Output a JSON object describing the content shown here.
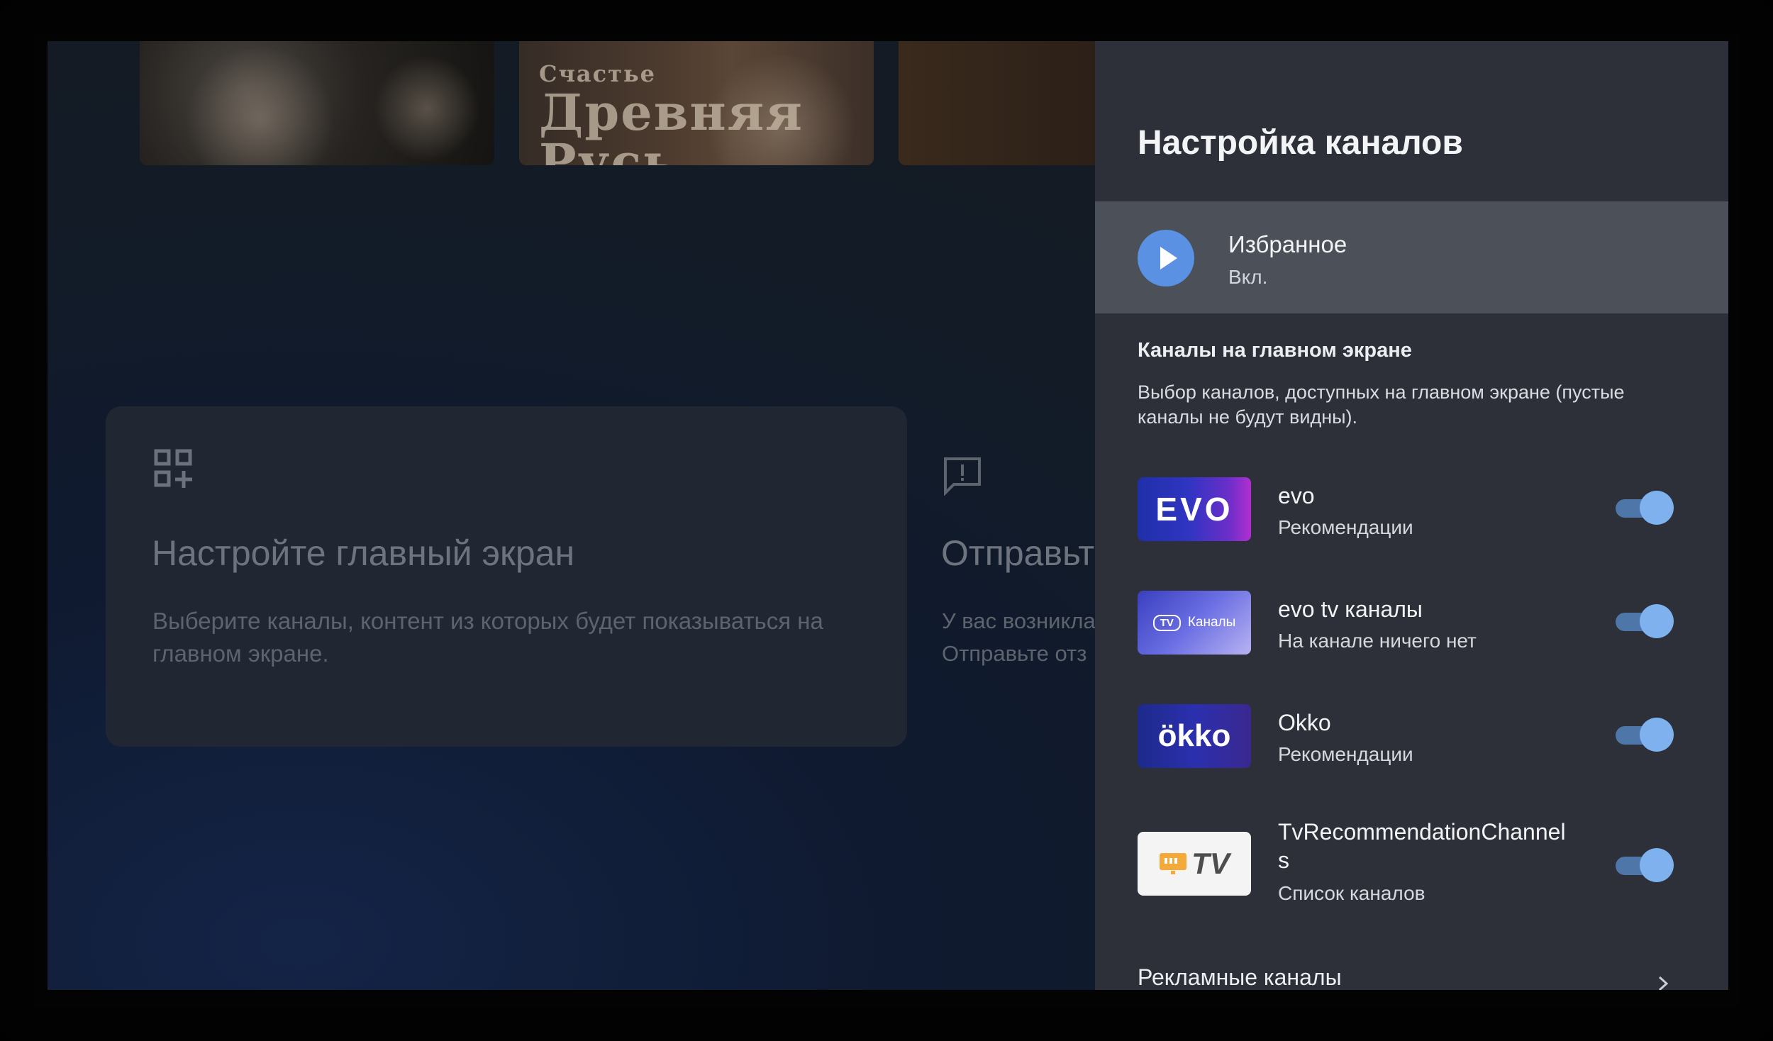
{
  "background": {
    "thumbnail_text_line1": "Счастье",
    "thumbnail_text_line2": "Древняя Русь",
    "card": {
      "title": "Настройте главный экран",
      "description": "Выберите каналы, контент из которых будет показываться на главном экране."
    },
    "card2": {
      "title": "Отправьт",
      "description_line1": "У вас возникла",
      "description_line2": "Отправьте отз"
    }
  },
  "panel": {
    "title": "Настройка каналов",
    "favorites": {
      "title": "Избранное",
      "status": "Вкл."
    },
    "section_title": "Каналы на главном экране",
    "section_description": "Выбор каналов, доступных на главном экране (пустые каналы не будут видны).",
    "channels": [
      {
        "name": "evo",
        "subtitle": "Рекомендации",
        "logo_text": "EVO",
        "enabled": true
      },
      {
        "name": "evo tv каналы",
        "subtitle": "На канале ничего нет",
        "logo_badge": "TV",
        "logo_text": "Каналы",
        "enabled": true
      },
      {
        "name": "Okko",
        "subtitle": "Рекомендации",
        "logo_text": "ökko",
        "enabled": true
      },
      {
        "name": "TvRecommendationChannels",
        "subtitle": "Список каналов",
        "logo_text": "TV",
        "enabled": true
      }
    ],
    "more_title": "Рекламные каналы"
  },
  "colors": {
    "accent": "#5a91e3",
    "toggle_track": "#4f76a8",
    "toggle_knob": "#7fb1ef",
    "panel_bg": "#2d3039",
    "selected_row": "#4b5059"
  },
  "icons": {
    "card_icon": "add-widget-icon",
    "card2_icon": "feedback-icon",
    "favorites_icon": "play-icon",
    "more_icon": "chevron-right-icon"
  }
}
